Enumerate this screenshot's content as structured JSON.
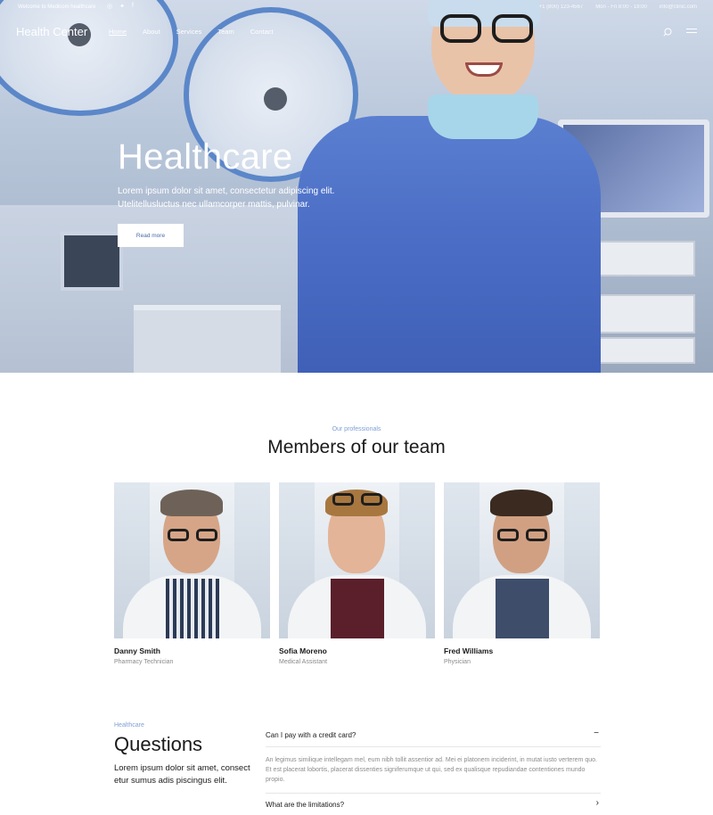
{
  "topbar": {
    "welcome": "Welcome to Medicom healthcare",
    "social": [
      "instagram-icon",
      "twitter-icon",
      "facebook-icon"
    ],
    "phone": "+1 (800) 123-4567",
    "hours": "Mon - Fri 8:00 - 18:00",
    "email": "info@clinic.com"
  },
  "nav": {
    "logo": "Health Center",
    "items": [
      "Home",
      "About",
      "Services",
      "Team",
      "Contact"
    ],
    "active": "Home"
  },
  "hero": {
    "title": "Healthcare",
    "subtitle": "Lorem ipsum dolor sit amet, consectetur adipiscing elit. Utelitellusluctus nec ullamcorper mattis, pulvinar.",
    "button": "Read more"
  },
  "team": {
    "eyebrow": "Our professionals",
    "title": "Members of our team",
    "members": [
      {
        "name": "Danny Smith",
        "role": "Pharmacy Technician"
      },
      {
        "name": "Sofia Moreno",
        "role": "Medical Assistant"
      },
      {
        "name": "Fred Williams",
        "role": "Physician"
      }
    ]
  },
  "faq": {
    "eyebrow": "Healthcare",
    "title": "Questions",
    "description": "Lorem ipsum dolor sit amet, consect etur sumus adis piscingus elit.",
    "items": [
      {
        "question": "Can I pay with a credit card?",
        "icon": "−",
        "answer": "An legimus similique intellegam mel, eum nibh tollit assentior ad. Mei ei platonem inciderint, in mutat iusto verterem quo. Et est placerat lobortis, placerat dissenties signiferumque ut qui, sed ex qualisque repudiandae contentiones mundo propio."
      },
      {
        "question": "What are the limitations?",
        "icon": "›"
      }
    ]
  },
  "colors": {
    "accent": "#7f9fd6",
    "button_text": "#4a6aa6",
    "scrubs": "#4a6cc4"
  }
}
